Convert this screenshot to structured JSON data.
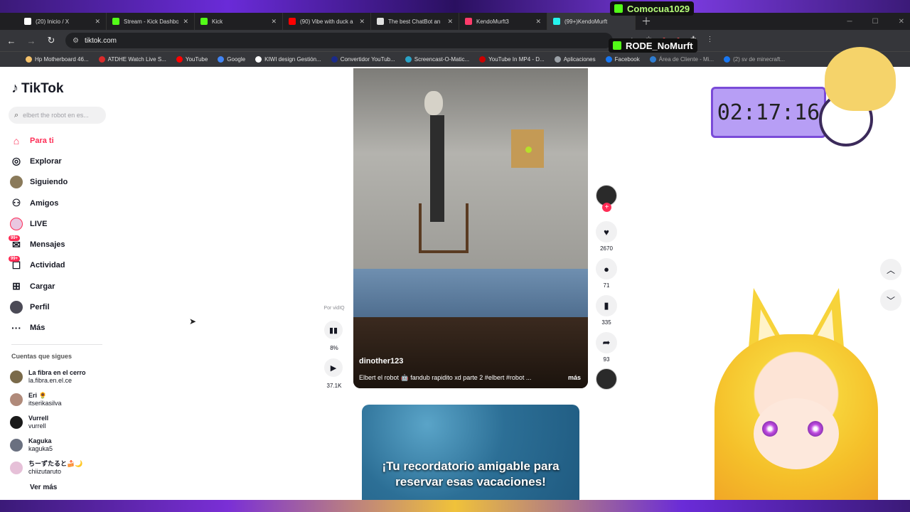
{
  "browser": {
    "tabs": [
      {
        "title": "(20) Inicio / X",
        "color": "#ffffff"
      },
      {
        "title": "Stream - Kick Dashbo",
        "color": "#53fc18"
      },
      {
        "title": "Kick",
        "color": "#53fc18"
      },
      {
        "title": "(90) Vibe with duck a",
        "color": "#ff0000"
      },
      {
        "title": "The best ChatBot an",
        "color": "#e0e0e0"
      },
      {
        "title": "KendoMurft3",
        "color": "#ff3b6b"
      },
      {
        "title": "(99+)KendoMurft",
        "color": "#25f4ee"
      }
    ],
    "url": "tiktok.com",
    "bookmarks": [
      {
        "label": "Hp Motherboard 46...",
        "color": "#f5c26b"
      },
      {
        "label": "ATDHE Watch Live S...",
        "color": "#d92b2b"
      },
      {
        "label": "YouTube",
        "color": "#ff0000"
      },
      {
        "label": "Google",
        "color": "#4285f4"
      },
      {
        "label": "KIWI design Gestión...",
        "color": "#ffffff"
      },
      {
        "label": "Convertidor YouTub...",
        "color": "#1b2a8a"
      },
      {
        "label": "Screencast-O-Matic...",
        "color": "#2aa3c7"
      },
      {
        "label": "YouTube In MP4 - D...",
        "color": "#cc0000"
      },
      {
        "label": "Aplicaciones",
        "color": "#9aa0a6"
      },
      {
        "label": "Facebook",
        "color": "#1877f2"
      },
      {
        "label": "Área de Cliente - Mi...",
        "color": "#2f7dd1"
      },
      {
        "label": "(2) sv de minecraft...",
        "color": "#1877f2"
      }
    ]
  },
  "tiktok": {
    "logo": "TikTok",
    "search_placeholder": "elbert the robot en es...",
    "nav": [
      {
        "label": "Para ti",
        "icon": "home-icon"
      },
      {
        "label": "Explorar",
        "icon": "compass-icon"
      },
      {
        "label": "Siguiendo",
        "icon": "following-avatar-icon"
      },
      {
        "label": "Amigos",
        "icon": "friends-icon"
      },
      {
        "label": "LIVE",
        "icon": "live-icon"
      },
      {
        "label": "Mensajes",
        "icon": "messages-icon",
        "badge": "99+"
      },
      {
        "label": "Actividad",
        "icon": "activity-icon",
        "badge": "99+"
      },
      {
        "label": "Cargar",
        "icon": "upload-icon"
      },
      {
        "label": "Perfil",
        "icon": "profile-icon"
      },
      {
        "label": "Más",
        "icon": "more-icon"
      }
    ],
    "following_title": "Cuentas que sigues",
    "following": [
      {
        "name": "La fibra en el cerro",
        "user": "la.fibra.en.el.ce"
      },
      {
        "name": "Eri 🌻",
        "user": "itserikasilva"
      },
      {
        "name": "Vurrell",
        "user": "vurrell"
      },
      {
        "name": "Kaguka",
        "user": "kaguka5"
      },
      {
        "name": "ちーずたると🍰🌙",
        "user": "chiizutaruto"
      }
    ],
    "see_more": "Ver más",
    "video": {
      "author": "dinother123",
      "description": "Elbert el robot 🤖 fandub rapidito xd parte 2 #elbert #robot ...",
      "more": "más",
      "promo_label": "Por vidIQ",
      "stat_percent": "8%",
      "views": "37.1K",
      "likes": "2670",
      "comments": "71",
      "saves": "335",
      "shares": "93"
    },
    "next_video_text": "¡Tu recordatorio amigable para reservar esas vacaciones!"
  },
  "overlays": {
    "kick_user_1": "Comocua1029",
    "kick_user_2": "RODE_NoMurft",
    "timer": "02:17:16"
  },
  "colors": {
    "accent": "#fe2c55",
    "kick": "#53fc18"
  }
}
